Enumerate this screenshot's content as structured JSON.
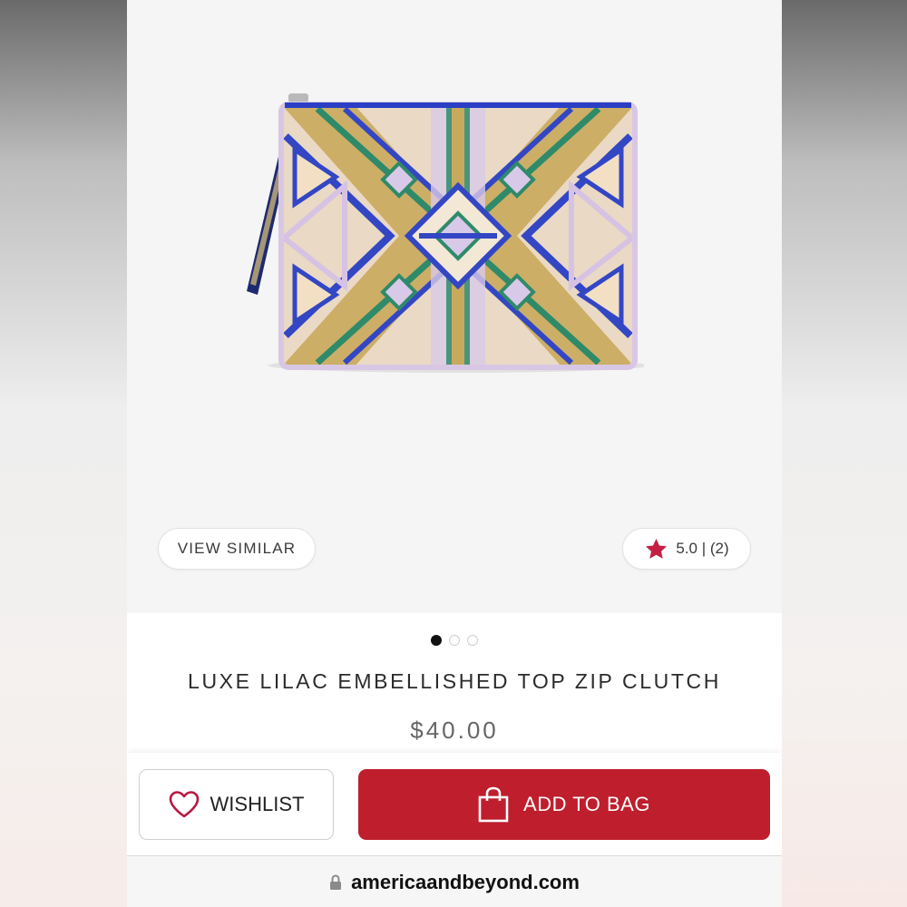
{
  "gallery": {
    "view_similar_label": "VIEW SIMILAR",
    "rating_text": "5.0 | (2)",
    "rating_icon": "star-icon",
    "image_count": 3,
    "active_image": 1
  },
  "product": {
    "title": "LUXE LILAC EMBELLISHED TOP ZIP CLUTCH",
    "price": "$40.00"
  },
  "actions": {
    "wishlist_label": "WISHLIST",
    "wishlist_icon": "heart-icon",
    "add_to_bag_label": "ADD TO BAG",
    "add_to_bag_icon": "shopping-bag-icon"
  },
  "browser": {
    "url": "americaandbeyond.com",
    "lock_icon": "lock-icon"
  },
  "colors": {
    "brand_red": "#bf1e2d",
    "star_red": "#c41f42",
    "heart_red": "#b8183f"
  }
}
